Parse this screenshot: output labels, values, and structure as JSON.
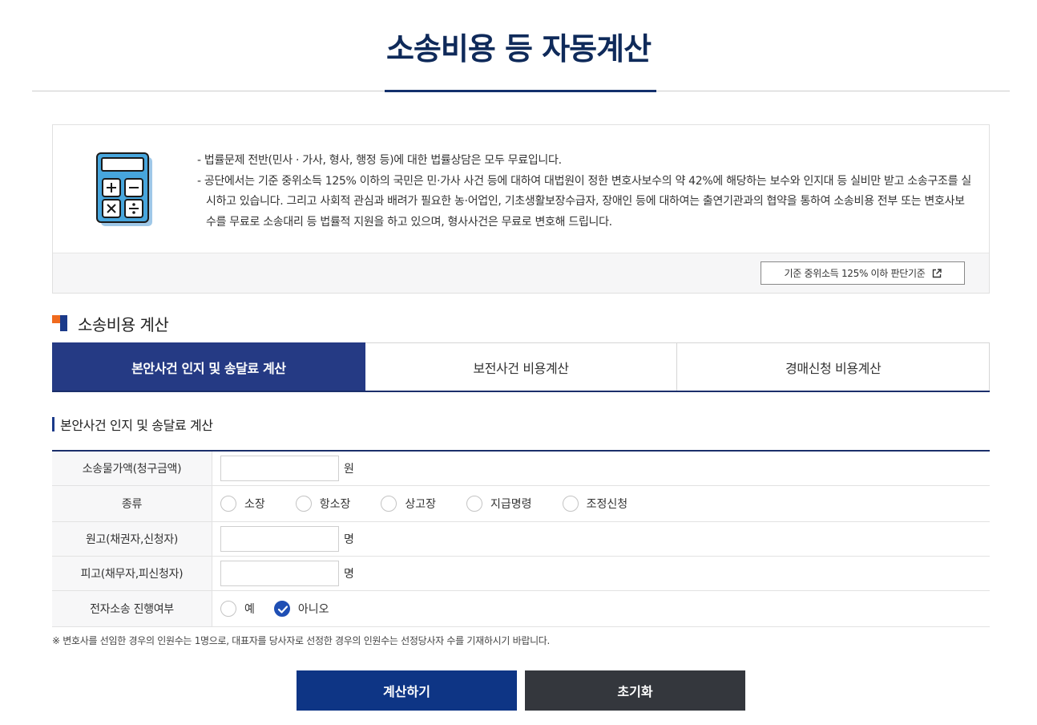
{
  "page": {
    "title": "소송비용 등 자동계산"
  },
  "info": {
    "lines": [
      "- 법률문제 전반(민사 · 가사, 형사, 행정 등)에 대한 법률상담은 모두 무료입니다.",
      "- 공단에서는 기준 중위소득 125% 이하의 국민은 민·가사 사건 등에 대하여 대법원이 정한 변호사보수의 약 42%에 해당하는 보수와 인지대 등 실비만 받고 소송구조를 실시하고 있습니다. 그리고 사회적 관심과 배려가 필요한 농·어업인, 기초생활보장수급자, 장애인 등에 대하여는 출연기관과의 협약을 통하여 소송비용 전부 또는 변호사보수를 무료로 소송대리 등 법률적 지원을 하고 있으며, 형사사건은 무료로 변호해 드립니다."
    ],
    "criteria_button": "기준 중위소득 125% 이하 판단기준",
    "icon": "calculator-icon"
  },
  "section": {
    "heading": "소송비용 계산"
  },
  "tabs": [
    {
      "label": "본안사건 인지 및 송달료 계산",
      "active": true
    },
    {
      "label": "보전사건 비용계산",
      "active": false
    },
    {
      "label": "경매신청 비용계산",
      "active": false
    }
  ],
  "form": {
    "heading": "본안사건 인지 및 송달료 계산",
    "rows": {
      "amount": {
        "label": "소송물가액(청구금액)",
        "value": "",
        "unit": "원"
      },
      "type": {
        "label": "종류",
        "options": [
          "소장",
          "항소장",
          "상고장",
          "지급명령",
          "조정신청"
        ],
        "selected": null
      },
      "plaintiff": {
        "label": "원고(채권자,신청자)",
        "value": "",
        "unit": "명"
      },
      "defendant": {
        "label": "피고(채무자,피신청자)",
        "value": "",
        "unit": "명"
      },
      "electronic": {
        "label": "전자소송 진행여부",
        "options": [
          "예",
          "아니오"
        ],
        "selected": "아니오"
      }
    },
    "note": "※ 변호사를 선임한 경우의 인원수는 1명으로, 대표자를 당사자로 선정한 경우의 인원수는 선정당사자 수를 기재하시기 바랍니다."
  },
  "buttons": {
    "calculate": "계산하기",
    "reset": "초기화"
  },
  "colors": {
    "title": "#0f2a5a",
    "active_tab": "#253a84",
    "calculate_button": "#0e3585",
    "reset_button": "#34373d",
    "heading_orange": "#f06a1e",
    "radio_checked": "#1f4fb4"
  }
}
